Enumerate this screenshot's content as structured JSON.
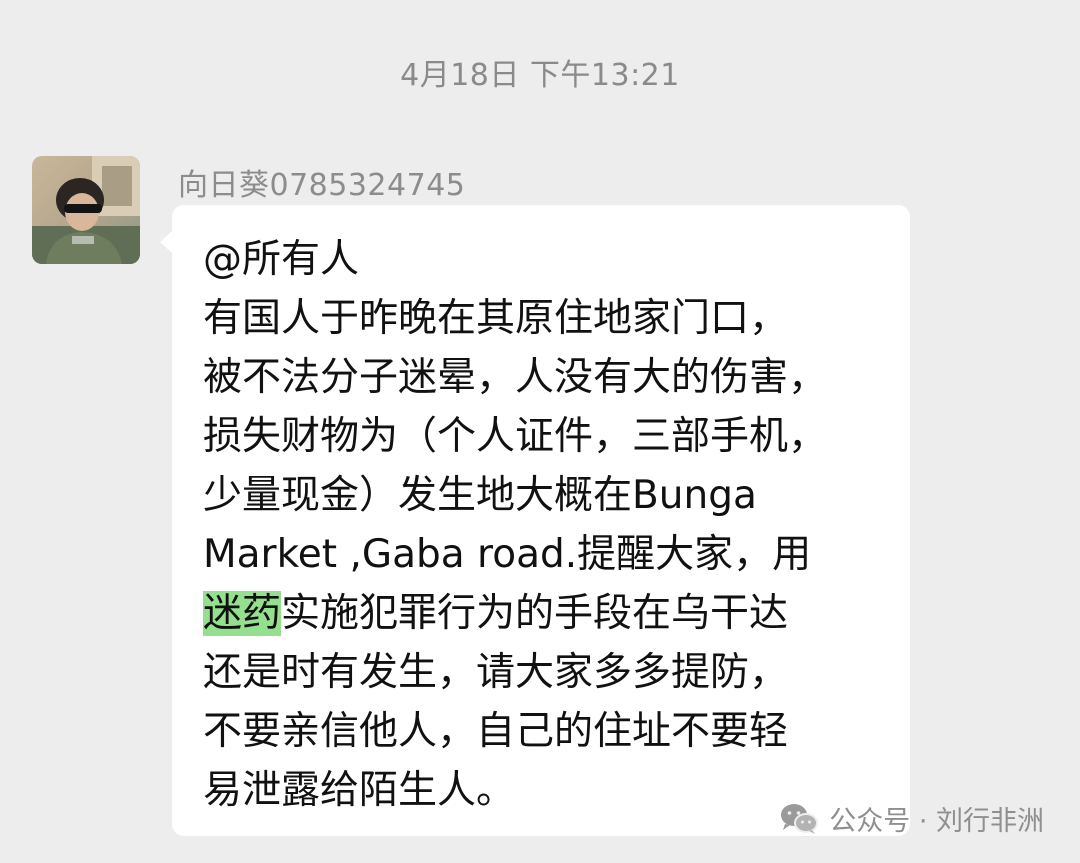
{
  "timestamp": "4月18日 下午13:21",
  "sender": {
    "name": "向日葵0785324745"
  },
  "message": {
    "lines": [
      "@所有人",
      "有国人于昨晚在其原住地家门口，",
      "被不法分子迷晕，人没有大的伤害，",
      "损失财物为（个人证件，三部手机，",
      "少量现金）发生地大概在Bunga",
      "Market ,Gaba road.提醒大家，用"
    ],
    "highlight_line": {
      "highlight": "迷药",
      "rest": "实施犯罪行为的手段在乌干达"
    },
    "lines_after": [
      "还是时有发生，请大家多多提防，",
      "不要亲信他人，自己的住址不要轻",
      "易泄露给陌生人。"
    ]
  },
  "watermark": {
    "text": "公众号 · 刘行非洲",
    "icon": "wechat-icon"
  },
  "colors": {
    "background": "#ededed",
    "bubble": "#ffffff",
    "highlight": "#95e08e",
    "meta_text": "#8a8a8a"
  }
}
